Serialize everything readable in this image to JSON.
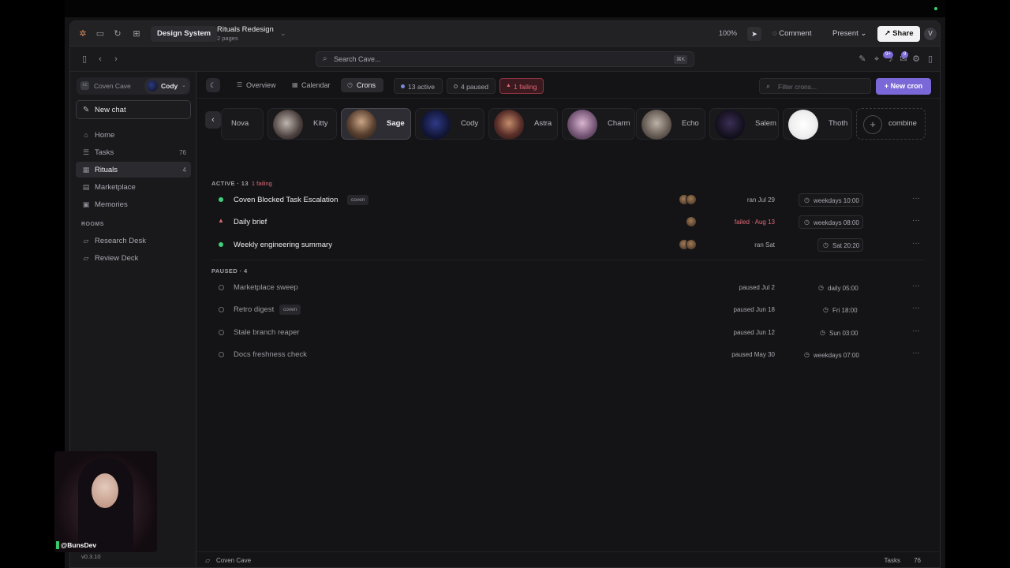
{
  "figma": {
    "file_label": "Design System",
    "project_title": "Rituals Redesign",
    "project_sub": "2 pages",
    "zoom": "100%",
    "comment_label": "Comment",
    "present_label": "Present",
    "share_label": "Share",
    "avatar_initial": "V"
  },
  "appbar": {
    "search_placeholder": "Search Cave...",
    "search_shortcut": "⌘K",
    "badge_a": "9+",
    "badge_b": "8"
  },
  "sidebar": {
    "workspace": "Coven Cave",
    "user": "Cody",
    "new_chat": "New chat",
    "nav": [
      {
        "label": "Home",
        "count": ""
      },
      {
        "label": "Tasks",
        "count": "76"
      },
      {
        "label": "Rituals",
        "count": "4"
      },
      {
        "label": "Marketplace",
        "count": ""
      },
      {
        "label": "Memories",
        "count": ""
      }
    ],
    "rooms_header": "ROOMS",
    "rooms": [
      "Research Desk",
      "Review Deck"
    ],
    "version": "v0.3.10"
  },
  "main": {
    "tabs": [
      {
        "label": "Overview"
      },
      {
        "label": "Calendar"
      },
      {
        "label": "Crons"
      }
    ],
    "chips": {
      "active": "13  active",
      "paused": "4  paused",
      "failing": "1  failing"
    },
    "filter_placeholder": "Filter crons...",
    "new_cron": "New cron",
    "agents": [
      "Nova",
      "Kitty",
      "Sage",
      "Cody",
      "Astra",
      "Charm",
      "Echo",
      "Salem",
      "Thoth",
      "combine"
    ],
    "active_header": "ACTIVE · 13",
    "active_failing": "1 failing",
    "active_rows": [
      {
        "title": "Coven Blocked Task Escalation",
        "tag": "coven",
        "last": "ran Jul 29",
        "schedule": "weekdays 10:00"
      },
      {
        "title": "Daily brief",
        "tag": "",
        "last": "failed · Aug 13",
        "schedule": "weekdays 08:00"
      },
      {
        "title": "Weekly engineering summary",
        "tag": "",
        "last": "ran Sat",
        "schedule": "Sat 20:20"
      }
    ],
    "paused_header": "PAUSED · 4",
    "paused_rows": [
      {
        "title": "Marketplace sweep",
        "tag": "",
        "last": "paused Jul 2",
        "schedule": "daily 05:00"
      },
      {
        "title": "Retro digest",
        "tag": "coven",
        "last": "paused Jun 18",
        "schedule": "Fri 18:00"
      },
      {
        "title": "Stale branch reaper",
        "tag": "",
        "last": "paused Jun 12",
        "schedule": "Sun 03:00"
      },
      {
        "title": "Docs freshness check",
        "tag": "",
        "last": "paused May 30",
        "schedule": "weekdays 07:00"
      }
    ]
  },
  "statusbar": {
    "workspace": "Coven Cave",
    "tasks_label": "Tasks",
    "tasks_count": "76"
  },
  "overlay": {
    "handle": "@BunsDev"
  },
  "colors": {
    "accent": "#7b68d8",
    "ok": "#3ecf7a",
    "fail": "#e06a78"
  }
}
